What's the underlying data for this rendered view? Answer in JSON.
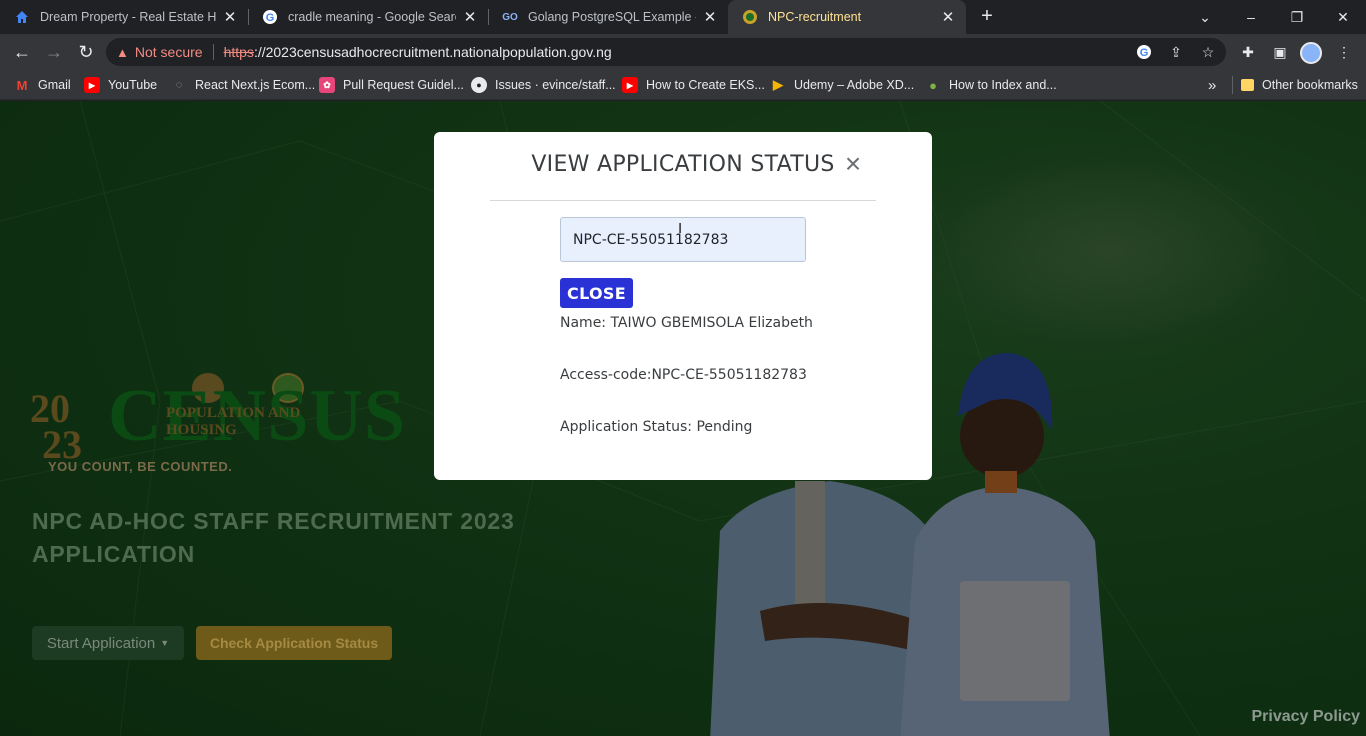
{
  "tabs": [
    {
      "title": "Dream Property - Real Estate HTML",
      "icon": "house-icon"
    },
    {
      "title": "cradle meaning - Google Search",
      "icon": "google-icon"
    },
    {
      "title": "Golang PostgreSQL Example - Go",
      "icon": "go-icon"
    },
    {
      "title": "NPC-recruitment",
      "icon": "npc-icon"
    }
  ],
  "toolbar": {
    "security_label": "Not secure",
    "url_scheme": "https",
    "url_rest": "://2023censusadhocrecruitment.nationalpopulation.gov.ng"
  },
  "bookmarks": [
    {
      "label": "Gmail",
      "icon": "gmail-icon"
    },
    {
      "label": "YouTube",
      "icon": "youtube-icon"
    },
    {
      "label": "React Next.js Ecom...",
      "icon": "bookmark-icon"
    },
    {
      "label": "Pull Request Guidel...",
      "icon": "bookmark-icon"
    },
    {
      "label": "Issues · evince/staff...",
      "icon": "github-icon"
    },
    {
      "label": "How to Create EKS...",
      "icon": "youtube-icon"
    },
    {
      "label": "Udemy – Adobe XD...",
      "icon": "udemy-icon"
    },
    {
      "label": "How to Index and...",
      "icon": "leaf-icon"
    }
  ],
  "bookmarks_more": "»",
  "other_bookmarks": "Other bookmarks",
  "logo": {
    "year_top": "20",
    "year_bottom": "23",
    "word": "CENSUS",
    "subtitle": "POPULATION AND HOUSING",
    "tagline": "YOU COUNT, BE COUNTED."
  },
  "page": {
    "headline": "NPC AD-HOC STAFF RECRUITMENT 2023 APPLICATION",
    "start_button": "Start Application",
    "check_button": "Check Application Status",
    "privacy": "Privacy Policy"
  },
  "modal": {
    "title": "VIEW APPLICATION STATUS",
    "input_value": "NPC-CE-55051182783",
    "close_button": "CLOSE",
    "name_line": "Name: TAIWO GBEMISOLA Elizabeth",
    "access_line": "Access-code:NPC-CE-55051182783",
    "status_line": "Application Status: Pending"
  },
  "colors": {
    "page_green": "#1f5a25",
    "close_button": "#2a32d6",
    "check_button": "#6e5b1a"
  }
}
